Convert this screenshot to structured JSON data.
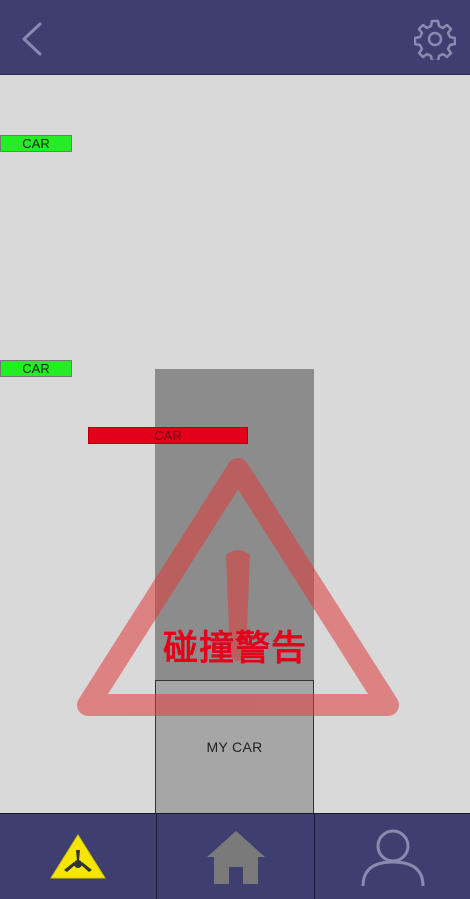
{
  "header": {
    "back_icon": "chevron-left-icon",
    "settings_icon": "gear-icon"
  },
  "road": {
    "cars": [
      {
        "label": "CAR",
        "status": "safe"
      },
      {
        "label": "CAR",
        "status": "safe"
      },
      {
        "label": "CAR",
        "status": "danger"
      }
    ],
    "my_car_label": "MY CAR",
    "warning_text": "碰撞警告"
  },
  "tabs": [
    {
      "name": "collision-warning",
      "icon": "warning-triangle-icon",
      "active": true
    },
    {
      "name": "home",
      "icon": "home-icon",
      "active": false
    },
    {
      "name": "profile",
      "icon": "user-icon",
      "active": false
    }
  ],
  "colors": {
    "bar": "#3f3e70",
    "road": "#d9d9d9",
    "safe_car": "#22ee22",
    "danger_car": "#e3001a",
    "warning_triangle": "#e06060",
    "active_tab_icon": "#f5e600"
  }
}
